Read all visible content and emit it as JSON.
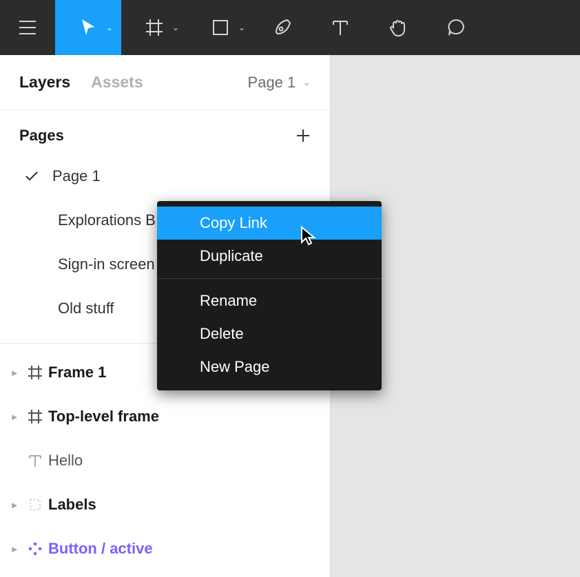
{
  "toolbar": {
    "tools": [
      {
        "name": "main-menu"
      },
      {
        "name": "move-tool",
        "active": true,
        "hasChevron": true
      },
      {
        "name": "frame-tool",
        "hasChevron": true
      },
      {
        "name": "shape-tool",
        "hasChevron": true
      },
      {
        "name": "pen-tool"
      },
      {
        "name": "text-tool"
      },
      {
        "name": "hand-tool"
      },
      {
        "name": "comment-tool"
      }
    ]
  },
  "tabs": {
    "layers": "Layers",
    "assets": "Assets",
    "currentPage": "Page 1"
  },
  "pagesSection": {
    "title": "Pages"
  },
  "pages": [
    {
      "label": "Page 1",
      "checked": true
    },
    {
      "label": "Explorations B"
    },
    {
      "label": "Sign-in screen"
    },
    {
      "label": "Old stuff"
    }
  ],
  "layers": [
    {
      "label": "Frame 1",
      "icon": "frame",
      "weight": "bold",
      "hasDisclosure": true
    },
    {
      "label": "Top-level frame",
      "icon": "frame",
      "weight": "bold",
      "hasDisclosure": true
    },
    {
      "label": "Hello",
      "icon": "text",
      "weight": "light"
    },
    {
      "label": "Labels",
      "icon": "group",
      "weight": "bold",
      "hasDisclosure": true
    },
    {
      "label": "Button / active",
      "icon": "component",
      "weight": "bold",
      "component": true,
      "hasDisclosure": true
    }
  ],
  "contextMenu": {
    "items": [
      {
        "label": "Copy Link",
        "highlight": true
      },
      {
        "label": "Duplicate"
      },
      {
        "divider": true
      },
      {
        "label": "Rename"
      },
      {
        "label": "Delete"
      },
      {
        "label": "New Page"
      }
    ]
  }
}
